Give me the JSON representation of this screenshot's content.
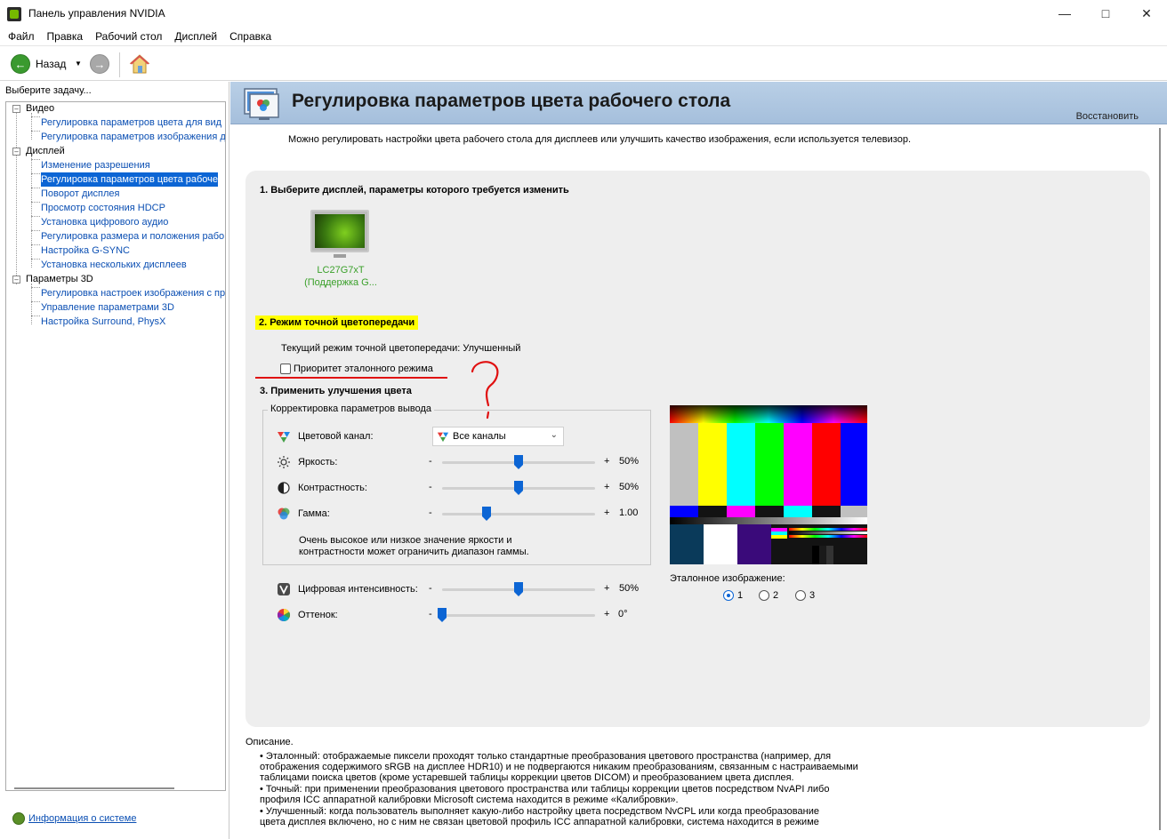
{
  "window": {
    "title": "Панель управления NVIDIA"
  },
  "menu": [
    "Файл",
    "Правка",
    "Рабочий стол",
    "Дисплей",
    "Справка"
  ],
  "toolbar": {
    "back_label": "Назад"
  },
  "left": {
    "header": "Выберите задачу...",
    "tree": [
      {
        "label": "Видео",
        "level": 0
      },
      {
        "label": "Регулировка параметров цвета для вид",
        "level": 1
      },
      {
        "label": "Регулировка параметров изображения д",
        "level": 1
      },
      {
        "label": "Дисплей",
        "level": 0
      },
      {
        "label": "Изменение разрешения",
        "level": 1
      },
      {
        "label": "Регулировка параметров цвета рабоче",
        "level": 1,
        "selected": true
      },
      {
        "label": "Поворот дисплея",
        "level": 1
      },
      {
        "label": "Просмотр состояния HDCP",
        "level": 1
      },
      {
        "label": "Установка цифрового аудио",
        "level": 1
      },
      {
        "label": "Регулировка размера и положения рабо",
        "level": 1
      },
      {
        "label": "Настройка G-SYNC",
        "level": 1
      },
      {
        "label": "Установка нескольких дисплеев",
        "level": 1
      },
      {
        "label": "Параметры 3D",
        "level": 0
      },
      {
        "label": "Регулировка настроек изображения с пр",
        "level": 1
      },
      {
        "label": "Управление параметрами 3D",
        "level": 1
      },
      {
        "label": "Настройка Surround, PhysX",
        "level": 1
      }
    ],
    "system_info": "Информация о системе"
  },
  "page": {
    "title": "Регулировка параметров цвета рабочего стола",
    "restore": "Восстановить",
    "intro": "Можно регулировать настройки цвета рабочего стола для дисплеев или улучшить качество изображения, если используется телевизор.",
    "step1": "1. Выберите дисплей, параметры которого требуется изменить",
    "monitor_name": "LC27G7xT",
    "monitor_sub": "(Поддержка G...",
    "step2": "2. Режим точной цветопередачи",
    "current_mode": "Текущий режим точной цветопередачи: Улучшенный",
    "ref_priority": "Приоритет эталонного режима",
    "step3": "3. Применить улучшения цвета",
    "group_title": "Корректировка параметров вывода",
    "channel_label": "Цветовой канал:",
    "channel_value": "Все каналы",
    "brightness_label": "Яркость:",
    "brightness_value": "50%",
    "brightness_level": 0.5,
    "contrast_label": "Контрастность:",
    "contrast_value": "50%",
    "contrast_level": 0.5,
    "gamma_label": "Гамма:",
    "gamma_value": "1.00",
    "gamma_level": 0.29,
    "note_line1": "Очень высокое или низкое значение яркости и",
    "note_line2": "контрастности может ограничить диапазон гаммы.",
    "vibrance_label": "Цифровая интенсивность:",
    "vibrance_value": "50%",
    "vibrance_level": 0.5,
    "hue_label": "Оттенок:",
    "hue_value": "0°",
    "hue_level": 0.0,
    "minus": "-",
    "plus": "+",
    "ref_image_label": "Эталонное изображение:",
    "ref_options": [
      "1",
      "2",
      "3"
    ],
    "ref_selected": "1",
    "desc_title": "Описание.",
    "desc_lines": [
      "• Эталонный: отображаемые пиксели проходят только стандартные преобразования цветового пространства (например, для",
      "отображения содержимого sRGB на дисплее HDR10) и не подвергаются никаким преобразованиям, связанным с настраиваемыми",
      "таблицами поиска цветов (кроме устаревшей таблицы коррекции цветов DICOM) и преобразованием цвета дисплея.",
      "• Точный: при применении преобразования цветового пространства или таблицы коррекции цветов посредством NvAPI либо",
      "профиля ICC аппаратной калибровки Microsoft система находится в режиме «Калибровки».",
      "• Улучшенный: когда пользователь выполняет какую-либо настройку цвета посредством NvCPL или когда преобразование",
      "цвета дисплея включено, но с ним не связан цветовой профиль ICC аппаратной калибровки, система находится в режиме"
    ]
  },
  "colors": {
    "accent": "#0c65d4",
    "highlight": "#ffff00",
    "annotation": "#e01010",
    "nvidia_green": "#76b900"
  }
}
